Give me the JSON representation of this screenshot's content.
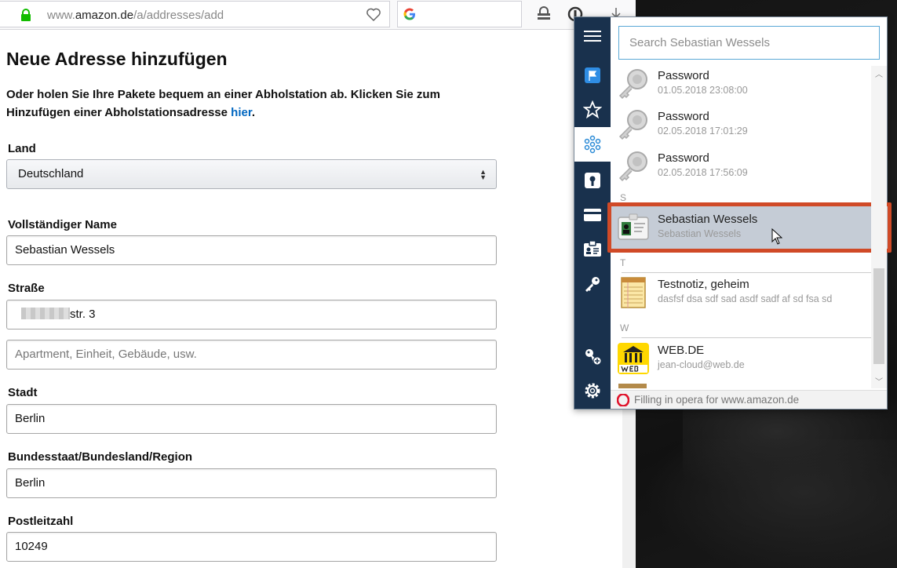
{
  "browser": {
    "url_prefix": "www.",
    "url_domain": "amazon.de",
    "url_path": "/a/addresses/add"
  },
  "page": {
    "title": "Neue Adresse hinzufügen",
    "intro_text": "Oder holen Sie Ihre Pakete bequem an einer Abholstation ab. Klicken Sie zum Hinzufügen einer Abholstationsadresse ",
    "intro_link": "hier",
    "intro_end": ".",
    "country_label": "Land",
    "country_value": "Deutschland",
    "name_label": "Vollständiger Name",
    "name_value": "Sebastian Wessels",
    "street_label": "Straße",
    "street_value": "str. 3",
    "apartment_placeholder": "Apartment, Einheit, Gebäude, usw.",
    "city_label": "Stadt",
    "city_value": "Berlin",
    "state_label": "Bundesstaat/Bundesland/Region",
    "state_value": "Berlin",
    "zip_label": "Postleitzahl",
    "zip_value": "10249"
  },
  "password_manager": {
    "search_placeholder": "Search Sebastian Wessels",
    "items": [
      {
        "title": "Password",
        "subtitle": "01.05.2018 23:08:00",
        "icon": "key-icon"
      },
      {
        "title": "Password",
        "subtitle": "02.05.2018 17:01:29",
        "icon": "key-icon"
      },
      {
        "title": "Password",
        "subtitle": "02.05.2018 17:56:09",
        "icon": "key-icon"
      }
    ],
    "group_s": "S",
    "selected_item": {
      "title": "Sebastian Wessels",
      "subtitle": "Sebastian Wessels",
      "icon": "identity-card-icon"
    },
    "group_t": "T",
    "note_item": {
      "title": "Testnotiz, geheim",
      "subtitle": "dasfsf dsa sdf sad asdf sadf af sd fsa sd",
      "icon": "notepad-icon"
    },
    "group_w": "W",
    "web_item": {
      "title": "WEB.DE",
      "subtitle": "jean-cloud@web.de",
      "icon": "webde-logo-icon"
    },
    "footer_text": "Filling in opera for www.amazon.de"
  },
  "colors": {
    "sidebar": "#19314d",
    "highlight_border": "#d04a27",
    "link": "#0066c0"
  }
}
